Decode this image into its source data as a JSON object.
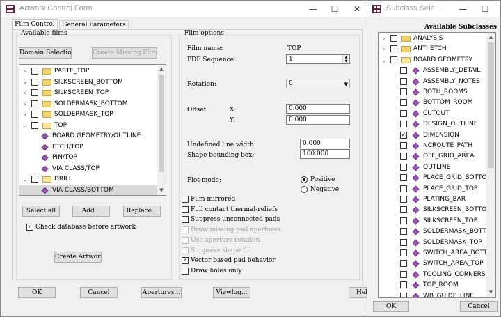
{
  "main_window": {
    "title": "Artwork Control Form",
    "tabs": [
      "Film Control",
      "General Parameters"
    ],
    "available_films": {
      "title": "Available films",
      "domain_selection": "Domain Selection",
      "create_missing": "Create Missing Films",
      "tree": [
        {
          "arrow": "›",
          "check": "",
          "icon": "folder",
          "label": "PASTE_TOP"
        },
        {
          "arrow": "›",
          "check": "",
          "icon": "folder",
          "label": "SILKSCREEN_BOTTOM"
        },
        {
          "arrow": "›",
          "check": "",
          "icon": "folder",
          "label": "SILKSCREEN_TOP"
        },
        {
          "arrow": "›",
          "check": "",
          "icon": "folder",
          "label": "SOLDERMASK_BOTTOM"
        },
        {
          "arrow": "›",
          "check": "",
          "icon": "folder",
          "label": "SOLDERMASK_TOP"
        },
        {
          "arrow": "⌄",
          "check": "",
          "icon": "folder-open",
          "label": "TOP"
        },
        {
          "arrow": "",
          "check": "",
          "icon": "layer",
          "label": "BOARD GEOMETRY/OUTLINE"
        },
        {
          "arrow": "",
          "check": "",
          "icon": "layer",
          "label": "ETCH/TOP"
        },
        {
          "arrow": "",
          "check": "",
          "icon": "layer",
          "label": "PIN/TOP"
        },
        {
          "arrow": "",
          "check": "",
          "icon": "layer",
          "label": "VIA CLASS/TOP"
        },
        {
          "arrow": "⌄",
          "check": "",
          "icon": "folder-open",
          "label": "DRILL"
        },
        {
          "arrow": "",
          "check": "",
          "icon": "layer",
          "label": "VIA CLASS/BOTTOM",
          "selected": true
        }
      ],
      "select_all": "Select all",
      "add": "Add...",
      "replace": "Replace...",
      "check_db_label": "Check database before artwork",
      "check_db_mark": "✓",
      "create_artwork": "Create Artwork"
    },
    "film_options": {
      "title": "Film options",
      "film_name_label": "Film name:",
      "film_name_value": "TOP",
      "pdf_seq_label": "PDF Sequence:",
      "pdf_seq_value": "1",
      "rotation_label": "Rotation:",
      "rotation_value": "0",
      "offset_label": "Offset",
      "x_label": "X:",
      "x_value": "0.000",
      "y_label": "Y:",
      "y_value": "0.000",
      "undef_line_label": "Undefined line width:",
      "undef_line_value": "0.000",
      "shape_bbox_label": "Shape bounding box:",
      "shape_bbox_value": "100.000",
      "plot_mode_label": "Plot mode:",
      "positive": "Positive",
      "negative": "Negative",
      "options": [
        {
          "label": "Film mirrored",
          "checked": "",
          "disabled": false
        },
        {
          "label": "Full contact thermal-reliefs",
          "checked": "",
          "disabled": false
        },
        {
          "label": "Suppress unconnected pads",
          "checked": "",
          "disabled": false
        },
        {
          "label": "Draw missing pad apertures",
          "checked": "",
          "disabled": true
        },
        {
          "label": "Use aperture rotation",
          "checked": "",
          "disabled": true
        },
        {
          "label": "Suppress shape fill",
          "checked": "",
          "disabled": true
        },
        {
          "label": "Vector based pad behavior",
          "checked": "✓",
          "disabled": false
        },
        {
          "label": "Draw holes only",
          "checked": "",
          "disabled": false
        }
      ]
    },
    "bottom_buttons": {
      "ok": "OK",
      "cancel": "Cancel",
      "apertures": "Apertures...",
      "viewlog": "Viewlog...",
      "help": "Help"
    }
  },
  "subclass_window": {
    "title": "Subclass Sele...",
    "header": "Available Subclasses",
    "items": [
      {
        "arrow": "›",
        "check": "",
        "icon": "folder",
        "label": "ANALYSIS"
      },
      {
        "arrow": "›",
        "check": "",
        "icon": "folder",
        "label": "ANTI ETCH"
      },
      {
        "arrow": "⌄",
        "check": "",
        "icon": "folder-open",
        "label": "BOARD GEOMETRY"
      },
      {
        "arrow": "",
        "check": "",
        "icon": "layer",
        "label": "ASSEMBLY_DETAIL"
      },
      {
        "arrow": "",
        "check": "",
        "icon": "layer",
        "label": "ASSEMBLY_NOTES"
      },
      {
        "arrow": "",
        "check": "",
        "icon": "layer",
        "label": "BOTH_ROOMS"
      },
      {
        "arrow": "",
        "check": "",
        "icon": "layer",
        "label": "BOTTOM_ROOM"
      },
      {
        "arrow": "",
        "check": "",
        "icon": "layer",
        "label": "CUTOUT"
      },
      {
        "arrow": "",
        "check": "",
        "icon": "layer",
        "label": "DESIGN_OUTLINE"
      },
      {
        "arrow": "",
        "check": "✓",
        "icon": "layer",
        "label": "DIMENSION"
      },
      {
        "arrow": "",
        "check": "",
        "icon": "layer",
        "label": "NCROUTE_PATH"
      },
      {
        "arrow": "",
        "check": "",
        "icon": "layer",
        "label": "OFF_GRID_AREA"
      },
      {
        "arrow": "",
        "check": "",
        "icon": "layer",
        "label": "OUTLINE"
      },
      {
        "arrow": "",
        "check": "",
        "icon": "layer",
        "label": "PLACE_GRID_BOTTOM"
      },
      {
        "arrow": "",
        "check": "",
        "icon": "layer",
        "label": "PLACE_GRID_TOP"
      },
      {
        "arrow": "",
        "check": "",
        "icon": "layer",
        "label": "PLATING_BAR"
      },
      {
        "arrow": "",
        "check": "",
        "icon": "layer",
        "label": "SILKSCREEN_BOTTOM"
      },
      {
        "arrow": "",
        "check": "",
        "icon": "layer",
        "label": "SILKSCREEN_TOP"
      },
      {
        "arrow": "",
        "check": "",
        "icon": "layer",
        "label": "SOLDERMASK_BOTTOM"
      },
      {
        "arrow": "",
        "check": "",
        "icon": "layer",
        "label": "SOLDERMASK_TOP"
      },
      {
        "arrow": "",
        "check": "",
        "icon": "layer",
        "label": "SWITCH_AREA_BOTTOM"
      },
      {
        "arrow": "",
        "check": "",
        "icon": "layer",
        "label": "SWITCH_AREA_TOP"
      },
      {
        "arrow": "",
        "check": "",
        "icon": "layer",
        "label": "TOOLING_CORNERS"
      },
      {
        "arrow": "",
        "check": "",
        "icon": "layer",
        "label": "TOP_ROOM"
      },
      {
        "arrow": "",
        "check": "",
        "icon": "layer",
        "label": "WB_GUIDE_LINE"
      }
    ],
    "ok": "OK",
    "cancel": "Cancel"
  },
  "window_controls": {
    "minimize": "—",
    "maximize": "☐",
    "close": "✕"
  }
}
